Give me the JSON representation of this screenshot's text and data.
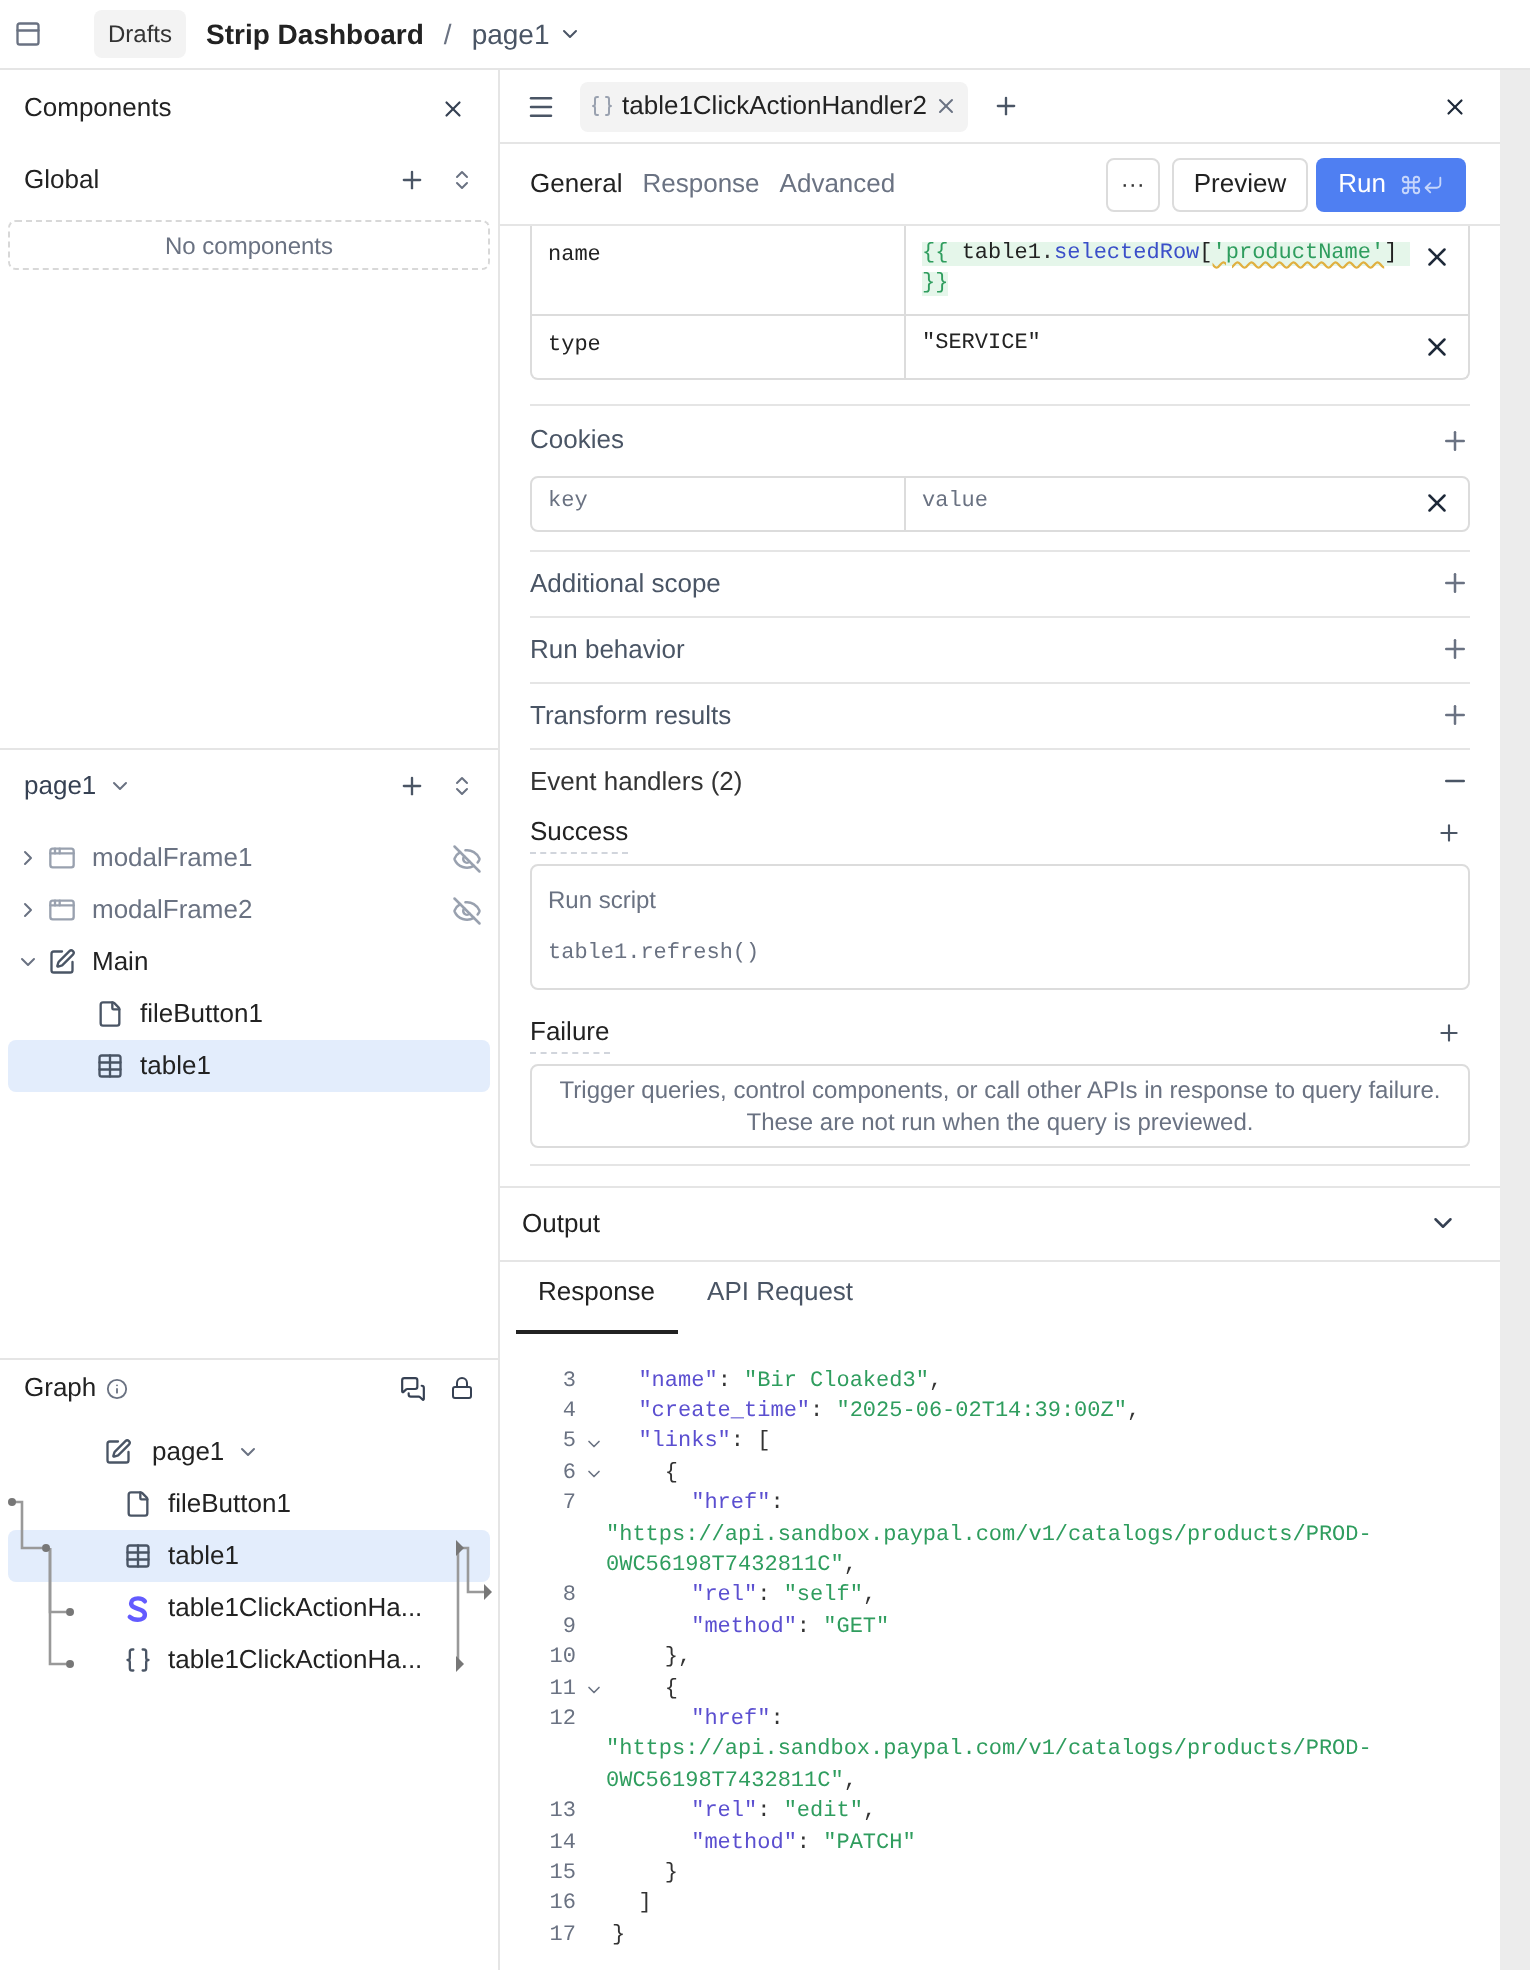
{
  "topbar": {
    "badge": "Drafts",
    "title": "Strip Dashboard",
    "separator": "/",
    "page": "page1"
  },
  "components_panel": {
    "title": "Components",
    "global_label": "Global",
    "empty_text": "No components"
  },
  "page_tree": {
    "title": "page1",
    "items": [
      {
        "label": "modalFrame1",
        "kind": "modal",
        "expanded": false,
        "hidden": true,
        "selected": false
      },
      {
        "label": "modalFrame2",
        "kind": "modal",
        "expanded": false,
        "hidden": true,
        "selected": false
      },
      {
        "label": "Main",
        "kind": "frame",
        "expanded": true,
        "hidden": false,
        "selected": false,
        "children": [
          {
            "label": "fileButton1",
            "kind": "file",
            "hidden": false,
            "selected": false
          },
          {
            "label": "table1",
            "kind": "table",
            "hidden": false,
            "selected": true
          }
        ]
      }
    ]
  },
  "graph": {
    "title": "Graph",
    "root": "page1",
    "nodes": [
      {
        "label": "fileButton1",
        "kind": "file",
        "selected": false
      },
      {
        "label": "table1",
        "kind": "table",
        "selected": true
      },
      {
        "label": "table1ClickActionHa...",
        "kind": "stripe",
        "selected": false
      },
      {
        "label": "table1ClickActionHa...",
        "kind": "query",
        "selected": false
      }
    ]
  },
  "query_tab": {
    "label": "table1ClickActionHandler2"
  },
  "editor_tabs": [
    {
      "label": "General",
      "selected": true
    },
    {
      "label": "Response",
      "selected": false
    },
    {
      "label": "Advanced",
      "selected": false
    }
  ],
  "actions": {
    "more": "···",
    "preview": "Preview",
    "run": "Run"
  },
  "params": [
    {
      "key": "name",
      "tokens": [
        {
          "kind": "brace",
          "text": "{{ "
        },
        {
          "kind": "plain",
          "text": "table1"
        },
        {
          "kind": "punct",
          "text": "."
        },
        {
          "kind": "prop",
          "text": "selectedRow"
        },
        {
          "kind": "plain",
          "text": "["
        },
        {
          "kind": "str",
          "text": "'productName'"
        },
        {
          "kind": "plain",
          "text": "] "
        },
        {
          "kind": "brace",
          "text": "}}"
        }
      ],
      "highlighted": true
    },
    {
      "key": "type",
      "tokens": [
        {
          "kind": "plain",
          "text": "\"SERVICE\""
        }
      ],
      "highlighted": false
    }
  ],
  "cookies": {
    "label": "Cookies",
    "key_placeholder": "key",
    "value_placeholder": "value"
  },
  "sections": [
    {
      "label": "Additional scope",
      "expanded": false
    },
    {
      "label": "Run behavior",
      "expanded": false
    },
    {
      "label": "Transform results",
      "expanded": false
    },
    {
      "label": "Event handlers (2)",
      "expanded": true
    }
  ],
  "success": {
    "label": "Success",
    "handler_title": "Run script",
    "handler_code": "table1.refresh()"
  },
  "failure": {
    "label": "Failure",
    "empty_text": "Trigger queries, control components, or call other APIs in response to query failure. These are not run when the query is previewed."
  },
  "output": {
    "title": "Output",
    "tabs": [
      {
        "label": "Response",
        "selected": true
      },
      {
        "label": "API Request",
        "selected": false
      }
    ],
    "lines": [
      {
        "num": "3",
        "fold": false,
        "tokens": [
          {
            "kind": "key",
            "text": "  \"name\""
          },
          {
            "kind": "punct",
            "text": ": "
          },
          {
            "kind": "string",
            "text": "\"Bir Cloaked3\""
          },
          {
            "kind": "punct",
            "text": ","
          }
        ]
      },
      {
        "num": "4",
        "fold": false,
        "tokens": [
          {
            "kind": "key",
            "text": "  \"create_time\""
          },
          {
            "kind": "punct",
            "text": ": "
          },
          {
            "kind": "string",
            "text": "\"2025-06-02T14:39:00Z\""
          },
          {
            "kind": "punct",
            "text": ","
          }
        ]
      },
      {
        "num": "5",
        "fold": true,
        "tokens": [
          {
            "kind": "key",
            "text": "  \"links\""
          },
          {
            "kind": "punct",
            "text": ": ["
          }
        ]
      },
      {
        "num": "6",
        "fold": true,
        "tokens": [
          {
            "kind": "punct",
            "text": "    {"
          }
        ]
      },
      {
        "num": "7",
        "fold": false,
        "tokens": [
          {
            "kind": "key",
            "text": "      \"href\""
          },
          {
            "kind": "punct",
            "text": ":"
          }
        ],
        "continuation": [
          {
            "kind": "string",
            "text": "\"https://api.sandbox.paypal.com/v1/catalogs/products/PROD-0WC56198T7432811C\""
          },
          {
            "kind": "punct",
            "text": ","
          }
        ]
      },
      {
        "num": "8",
        "fold": false,
        "tokens": [
          {
            "kind": "key",
            "text": "      \"rel\""
          },
          {
            "kind": "punct",
            "text": ": "
          },
          {
            "kind": "string",
            "text": "\"self\""
          },
          {
            "kind": "punct",
            "text": ","
          }
        ]
      },
      {
        "num": "9",
        "fold": false,
        "tokens": [
          {
            "kind": "key",
            "text": "      \"method\""
          },
          {
            "kind": "punct",
            "text": ": "
          },
          {
            "kind": "string",
            "text": "\"GET\""
          }
        ]
      },
      {
        "num": "10",
        "fold": false,
        "tokens": [
          {
            "kind": "punct",
            "text": "    },"
          }
        ]
      },
      {
        "num": "11",
        "fold": true,
        "tokens": [
          {
            "kind": "punct",
            "text": "    {"
          }
        ]
      },
      {
        "num": "12",
        "fold": false,
        "tokens": [
          {
            "kind": "key",
            "text": "      \"href\""
          },
          {
            "kind": "punct",
            "text": ":"
          }
        ],
        "continuation": [
          {
            "kind": "string",
            "text": "\"https://api.sandbox.paypal.com/v1/catalogs/products/PROD-0WC56198T7432811C\""
          },
          {
            "kind": "punct",
            "text": ","
          }
        ]
      },
      {
        "num": "13",
        "fold": false,
        "tokens": [
          {
            "kind": "key",
            "text": "      \"rel\""
          },
          {
            "kind": "punct",
            "text": ": "
          },
          {
            "kind": "string",
            "text": "\"edit\""
          },
          {
            "kind": "punct",
            "text": ","
          }
        ]
      },
      {
        "num": "14",
        "fold": false,
        "tokens": [
          {
            "kind": "key",
            "text": "      \"method\""
          },
          {
            "kind": "punct",
            "text": ": "
          },
          {
            "kind": "string",
            "text": "\"PATCH\""
          }
        ]
      },
      {
        "num": "15",
        "fold": false,
        "tokens": [
          {
            "kind": "punct",
            "text": "    }"
          }
        ]
      },
      {
        "num": "16",
        "fold": false,
        "tokens": [
          {
            "kind": "punct",
            "text": "  ]"
          }
        ]
      },
      {
        "num": "17",
        "fold": false,
        "tokens": [
          {
            "kind": "punct",
            "text": "}"
          }
        ]
      }
    ]
  }
}
